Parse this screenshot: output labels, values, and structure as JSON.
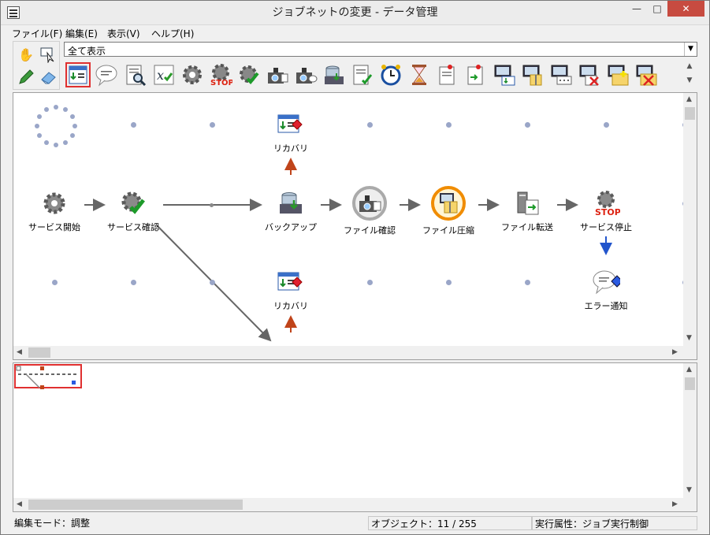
{
  "window": {
    "title": "ジョブネットの変更 - データ管理"
  },
  "menu": [
    {
      "label": "ファイル(F)"
    },
    {
      "label": "編集(E)"
    },
    {
      "label": "表示(V)"
    },
    {
      "label": "ヘルプ(H)"
    }
  ],
  "toolbar": {
    "view_filter_value": "全て表示",
    "icons": [
      "jobnet-icon",
      "message-icon",
      "file-search-icon",
      "formula-icon",
      "gear-icon",
      "stop-icon",
      "gear-check-icon",
      "camera-job-icon",
      "camera-msg-icon",
      "db-backup-icon",
      "checklist-icon",
      "alarm-clock-icon",
      "hourglass-icon",
      "pin-doc-icon",
      "pin-doc2-icon",
      "pc-download-icon",
      "pc-zip-icon",
      "pc-msg-icon",
      "pc-delete-icon",
      "new-folder-icon",
      "folder-delete-icon"
    ]
  },
  "flow": {
    "nodes": [
      {
        "id": "start",
        "label": "サービス開始",
        "icon": "gear-icon"
      },
      {
        "id": "check",
        "label": "サービス確認",
        "icon": "gear-check-icon"
      },
      {
        "id": "backup",
        "label": "バックアップ",
        "icon": "db-backup-icon"
      },
      {
        "id": "filecheck",
        "label": "ファイル確認",
        "icon": "camera-check-icon"
      },
      {
        "id": "compress",
        "label": "ファイル圧縮",
        "icon": "zip-icon"
      },
      {
        "id": "transfer",
        "label": "ファイル転送",
        "icon": "transfer-icon"
      },
      {
        "id": "stop",
        "label": "サービス停止",
        "icon": "stop-gear-icon"
      },
      {
        "id": "recovery1",
        "label": "リカバリ",
        "icon": "recovery-icon"
      },
      {
        "id": "recovery2",
        "label": "リカバリ",
        "icon": "recovery-icon"
      },
      {
        "id": "error",
        "label": "エラー通知",
        "icon": "error-message-icon"
      }
    ]
  },
  "status": {
    "mode": "編集モード：調整",
    "objects": "オブジェクト：11 / 255",
    "exec_attr": "実行属性：ジョブ実行制御"
  },
  "colors": {
    "close_button": "#c74b40",
    "selection_red": "#e03030",
    "arrow_gray": "#666666",
    "arrow_orange": "#c0441a",
    "arrow_blue": "#2255cc",
    "grid_dot": "#9aa6c8"
  }
}
